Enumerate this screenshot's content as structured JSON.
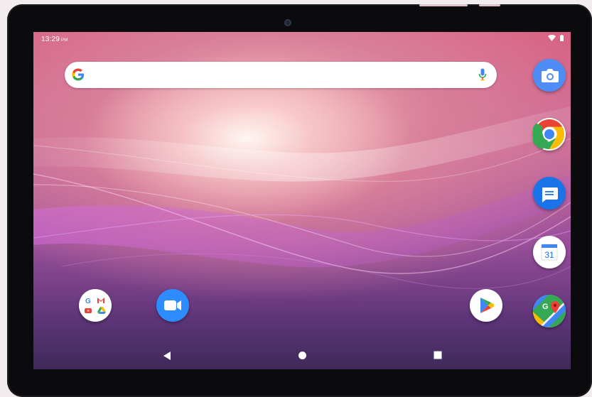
{
  "status_bar": {
    "time": "13:29",
    "ampm": "PM",
    "icons": [
      "wifi-icon",
      "battery-icon"
    ]
  },
  "search_bar": {
    "icons": [
      "google-g-icon",
      "microphone-icon"
    ]
  },
  "dock_right": {
    "apps": [
      "camera-icon",
      "chrome-icon",
      "messages-icon",
      "calendar-icon",
      "maps-icon"
    ],
    "calendar_day": "31"
  },
  "home_row": {
    "apps": [
      "google-apps-folder-icon",
      "zoom-icon",
      "play-store-icon"
    ]
  },
  "nav_bar": {
    "buttons": [
      "back-icon",
      "home-icon",
      "recents-icon"
    ]
  },
  "colors": {
    "wallpaper_top": "#d85d7f",
    "wallpaper_bottom": "#3e2a59",
    "bezel": "#0b0b0d",
    "google_blue": "#4285F4",
    "google_red": "#EA4335",
    "google_yellow": "#FBBC05",
    "google_green": "#34A853"
  }
}
